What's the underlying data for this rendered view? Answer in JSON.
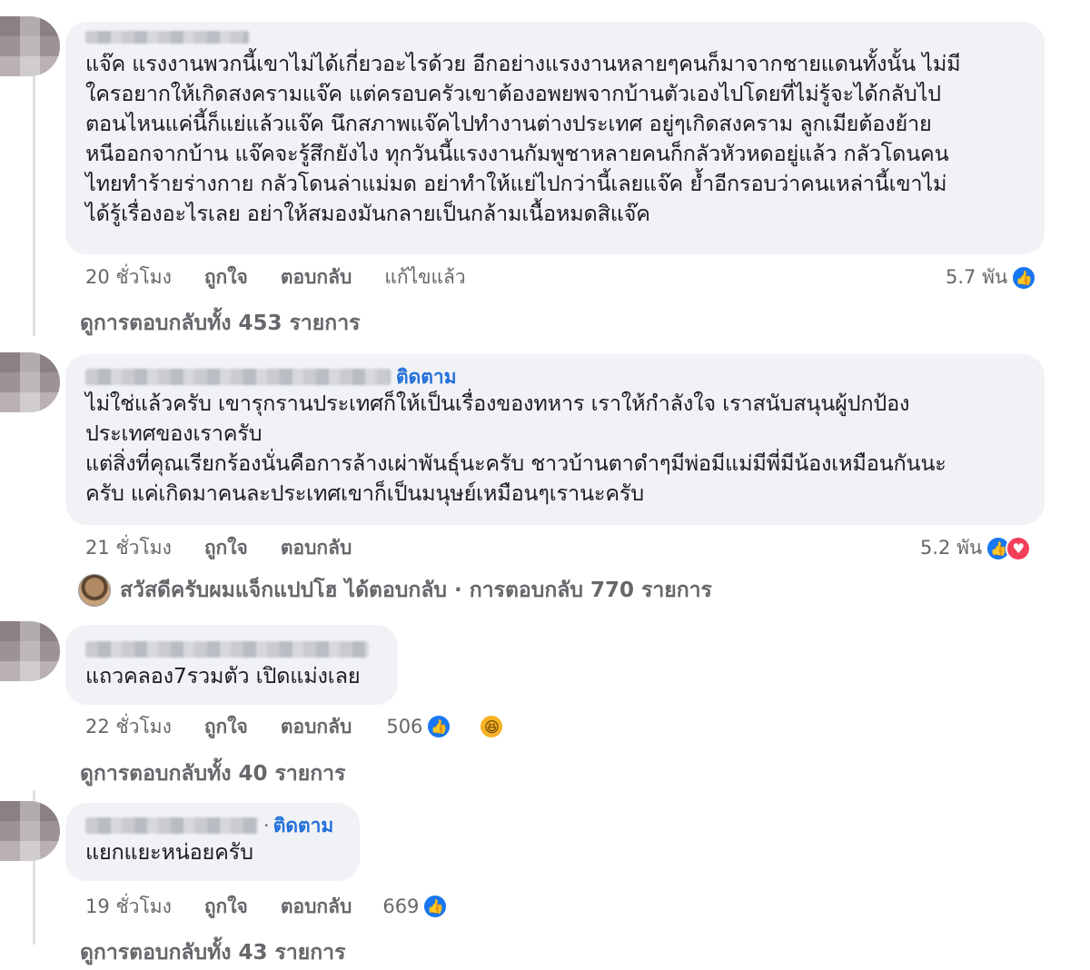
{
  "comments": [
    {
      "text": "แจ๊ค แรงงานพวกนี้เขาไม่ได้เกี่ยวอะไรด้วย อีกอย่างแรงงานหลายๆคนก็มาจากชายแดนทั้งนั้น ไม่มี\nใครอยากให้เกิดสงครามแจ๊ค แต่ครอบครัวเขาต้องอพยพจากบ้านตัวเองไปโดยที่ไม่รู้จะได้กลับไป\nตอนไหนแค่นี้ก็แย่แล้วแจ๊ค นึกสภาพแจ๊คไปทำงานต่างประเทศ อยู่ๆเกิดสงคราม ลูกเมียต้องย้าย\nหนีออกจากบ้าน แจ๊คจะรู้สึกยังไง ทุกวันนี้แรงงานกัมพูชาหลายคนก็กลัวหัวหดอยู่แล้ว กลัวโดนคน\nไทยทำร้ายร่างกาย กลัวโดนล่าแม่มด อย่าทำให้แย่ไปกว่านี้เลยแจ๊ค ย้ำอีกรอบว่าคนเหล่านี้เขาไม่\nได้รู้เรื่องอะไรเลย อย่าให้สมองมันกลายเป็นกล้ามเนื้อหมดสิแจ๊ค",
      "time": "20 ชั่วโมง",
      "like": "ถูกใจ",
      "reply": "ตอบกลับ",
      "edited": "แก้ไขแล้ว",
      "reaction_count": "5.7 พัน",
      "view_replies": "ดูการตอบกลับทั้ง 453 รายการ"
    },
    {
      "follow": "ติดตาม",
      "text": "ไม่ใช่แล้วครับ เขารุกรานประเทศก็ให้เป็นเรื่องของทหาร เราให้กำลังใจ เราสนับสนุนผู้ปกป้อง\nประเทศของเราครับ\nแต่สิ่งที่คุณเรียกร้องนั่นคือการล้างเผ่าพันธุ์นะครับ ชาวบ้านตาดำๆมีพ่อมีแม่มีพี่มีน้องเหมือนกันนะ\nครับ แค่เกิดมาคนละประเทศเขาก็เป็นมนุษย์เหมือนๆเรานะครับ",
      "time": "21 ชั่วโมง",
      "like": "ถูกใจ",
      "reply": "ตอบกลับ",
      "reaction_count": "5.2 พัน",
      "reply_summary": "สวัสดีครับผมแจ็กแปปโฮ ได้ตอบกลับ · การตอบกลับ 770 รายการ"
    },
    {
      "text": "แถวคลอง7รวมตัว เปิดแม่งเลย",
      "time": "22 ชั่วโมง",
      "like": "ถูกใจ",
      "reply": "ตอบกลับ",
      "reaction_count": "506",
      "view_replies": "ดูการตอบกลับทั้ง 40 รายการ"
    },
    {
      "follow_dot": "·",
      "follow": "ติดตาม",
      "text": "แยกแยะหน่อยครับ",
      "time": "19 ชั่วโมง",
      "like": "ถูกใจ",
      "reply": "ตอบกลับ",
      "reaction_count": "669",
      "view_replies": "ดูการตอบกลับทั้ง 43 รายการ"
    }
  ],
  "icons": {
    "like": "like-reaction-icon",
    "love": "love-reaction-icon",
    "haha": "haha-reaction-icon"
  },
  "colors": {
    "bubble": "#f0f2f5",
    "meta": "#65676b",
    "follow": "#216fdb",
    "like": "#1877f2",
    "love": "#f33e58"
  }
}
